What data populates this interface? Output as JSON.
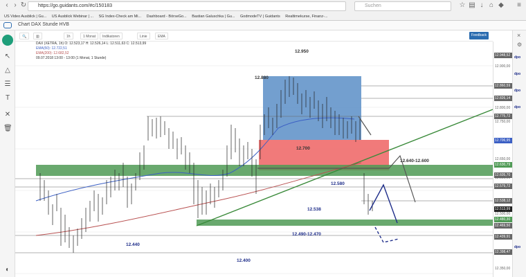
{
  "browser": {
    "url": "https://go.guidants.com/#c/150183",
    "search_placeholder": "Suchen",
    "bookmarks": [
      "US Video Ausblick | Gu...",
      "US Ausblick Webinar | ...",
      "SG Index-Check am Mi...",
      "Dashboard - BörseGo...",
      "Bastian Galuschka | Gu...",
      "GodmodeTV | Guidants",
      "Realtimekurse, Finanz-..."
    ]
  },
  "app": {
    "title": "Chart DAX Stunde HVB",
    "toolbar": [
      "1h",
      "1 Monat",
      "Linie",
      "EMA",
      "Indikatoren"
    ],
    "feedback": "Feedback"
  },
  "right_rail": [
    "dpo",
    "dpo",
    "dpo",
    "dpo",
    "dpo"
  ],
  "chart": {
    "info_line1": "DAX (XETRA, 1h)  O: 12.523,17  H: 12.526,14  L: 12.511,63  C: 12.513,99",
    "info_line2": "EMA(50): 12.722,51",
    "info_line3": "EMA(200): 12.682,52",
    "info_line4": "09.07.2018 13:00 - 13:00   (1 Monat, 1 Stunde)",
    "annotations": {
      "top": "12.950",
      "box": "12.880",
      "red": "12.700",
      "r1": "12.640-12.600",
      "r2": "12.580",
      "mid": "12.538",
      "low1": "12.490-12.470",
      "low2": "12.440",
      "low3": "12.400"
    },
    "price_ticks": [
      "12.950,00",
      "12.900,00",
      "12.850,00",
      "12.800,00",
      "12.750,00",
      "12.700,00",
      "12.650,00",
      "12.600,00",
      "12.550,00",
      "12.500,00",
      "12.450,00",
      "12.400,00",
      "12.350,00"
    ],
    "price_tags": [
      "12.948,52",
      "12.860,59",
      "12.826,14",
      "12.775,72",
      "12.706,95",
      "12.630,79",
      "12.605,70",
      "12.579,72",
      "12.538,12",
      "12.513,99",
      "12.480,30",
      "12.469,50",
      "12.439,91",
      "12.398,47"
    ],
    "colors": {
      "blue_box": "#5b8ec7",
      "red_box": "#ef6b6b",
      "green_zone": "#4f9a55",
      "trend": "#3a8a3a",
      "ema50": "#3b5fc4",
      "ema200": "#b85050",
      "navy": "#1f2e8a"
    }
  }
}
